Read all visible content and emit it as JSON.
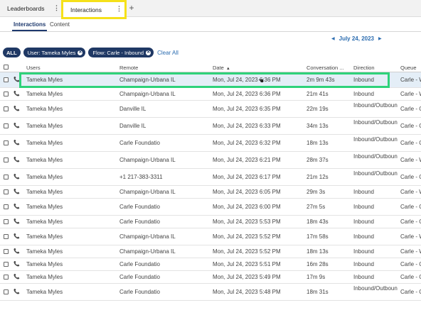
{
  "tabs": {
    "leaderboards": "Leaderboards",
    "interactions": "Interactions",
    "kebab": "⋮",
    "add": "+"
  },
  "subtabs": {
    "interactions": "Interactions",
    "content": "Content"
  },
  "date_nav": {
    "prev": "◀",
    "date": "July 24, 2023",
    "next": "▶"
  },
  "filters": {
    "all": "ALL",
    "user": "User: Tameka Myles",
    "flow": "Flow: Carle - Inbound",
    "clear": "Clear All"
  },
  "columns": {
    "users": "Users",
    "remote": "Remote",
    "date": "Date",
    "conversation": "Conversation ...",
    "direction": "Direction",
    "queue": "Queue"
  },
  "rows": [
    {
      "user": "Tameka Myles",
      "remote": "Champaign-Urbana IL",
      "date": "Mon, Jul 24, 2023 6:36 PM",
      "conv": "2m 9m 43s",
      "direction": "Inbound",
      "queue": "Carle - W"
    },
    {
      "user": "Tameka Myles",
      "remote": "Champaign-Urbana IL",
      "date": "Mon, Jul 24, 2023 6:36 PM",
      "conv": "21m 41s",
      "direction": "Inbound",
      "queue": "Carle - W"
    },
    {
      "user": "Tameka Myles",
      "remote": "Danville IL",
      "date": "Mon, Jul 24, 2023 6:35 PM",
      "conv": "22m 19s",
      "direction": "Inbound/Outbound",
      "queue": "Carle - C"
    },
    {
      "user": "Tameka Myles",
      "remote": "Danville IL",
      "date": "Mon, Jul 24, 2023 6:33 PM",
      "conv": "34m 13s",
      "direction": "Inbound/Outbound",
      "queue": "Carle - C"
    },
    {
      "user": "Tameka Myles",
      "remote": "Carle Foundatio",
      "date": "Mon, Jul 24, 2023 6:32 PM",
      "conv": "18m 13s",
      "direction": "Inbound/Outbound",
      "queue": "Carle - C"
    },
    {
      "user": "Tameka Myles",
      "remote": "Champaign-Urbana IL",
      "date": "Mon, Jul 24, 2023 6:21 PM",
      "conv": "28m 37s",
      "direction": "Inbound/Outbound",
      "queue": "Carle - W"
    },
    {
      "user": "Tameka Myles",
      "remote": "+1 217-383-3311",
      "date": "Mon, Jul 24, 2023 6:17 PM",
      "conv": "21m 12s",
      "direction": "Inbound/Outbound",
      "queue": "Carle - C"
    },
    {
      "user": "Tameka Myles",
      "remote": "Champaign-Urbana IL",
      "date": "Mon, Jul 24, 2023 6:05 PM",
      "conv": "29m 3s",
      "direction": "Inbound",
      "queue": "Carle - W"
    },
    {
      "user": "Tameka Myles",
      "remote": "Carle Foundatio",
      "date": "Mon, Jul 24, 2023 6:00 PM",
      "conv": "27m 5s",
      "direction": "Inbound",
      "queue": "Carle - C"
    },
    {
      "user": "Tameka Myles",
      "remote": "Carle Foundatio",
      "date": "Mon, Jul 24, 2023 5:53 PM",
      "conv": "18m 43s",
      "direction": "Inbound",
      "queue": "Carle - C"
    },
    {
      "user": "Tameka Myles",
      "remote": "Champaign-Urbana IL",
      "date": "Mon, Jul 24, 2023 5:52 PM",
      "conv": "17m 58s",
      "direction": "Inbound",
      "queue": "Carle - W"
    },
    {
      "user": "Tameka Myles",
      "remote": "Champaign-Urbana IL",
      "date": "Mon, Jul 24, 2023 5:52 PM",
      "conv": "18m 13s",
      "direction": "Inbound",
      "queue": "Carle - W"
    },
    {
      "user": "Tameka Myles",
      "remote": "Carle Foundatio",
      "date": "Mon, Jul 24, 2023 5:51 PM",
      "conv": "16m 28s",
      "direction": "Inbound",
      "queue": "Carle - C"
    },
    {
      "user": "Tameka Myles",
      "remote": "Carle Foundatio",
      "date": "Mon, Jul 24, 2023 5:49 PM",
      "conv": "17m 9s",
      "direction": "Inbound",
      "queue": "Carle - C"
    },
    {
      "user": "Tameka Myles",
      "remote": "Carle Foundatio",
      "date": "Mon, Jul 24, 2023 5:48 PM",
      "conv": "18m 31s",
      "direction": "Inbound/Outbound",
      "queue": "Carle - C"
    }
  ],
  "colors": {
    "chip_bg": "#1f3864",
    "link": "#2b6cb0",
    "tab_highlight": "#f5e11a",
    "row_highlight": "#2ed27a",
    "selected_row": "#e4eef7"
  }
}
